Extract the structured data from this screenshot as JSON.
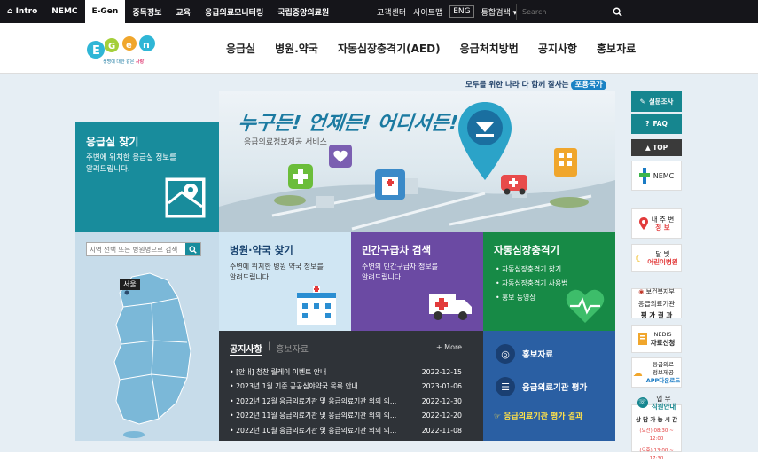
{
  "topbar": {
    "left_tabs": [
      "Intro",
      "NEMC",
      "E-Gen",
      "중독정보",
      "교육",
      "응급의료모니터링",
      "국립중앙의료원"
    ],
    "active_tab": "E-Gen",
    "right_links": [
      "고객센터",
      "사이트맵"
    ],
    "eng": "ENG",
    "unified_search": "통합검색",
    "search_placeholder": "Search"
  },
  "logo": {
    "text": "E-Gen",
    "tagline_a": "생명에 대한 같은",
    "tagline_b": "사랑"
  },
  "nav": [
    "응급실",
    "병원.약국",
    "자동심장충격기(AED)",
    "응급처치방법",
    "공지사항",
    "홍보자료"
  ],
  "slogan": {
    "text": "모두를 위한 나라 다 함께 잘사는",
    "badge": "포용국가"
  },
  "hero": {
    "title": "누구든! 언제든! 어디서든!",
    "sub": "응급의료정보제공 서비스"
  },
  "er_tile": {
    "title": "응급실 찾기",
    "desc1": "주변에 위치한 응급실 정보를",
    "desc2": "알려드립니다."
  },
  "map": {
    "placeholder": "지역 선택 또는 병원명으로 검색",
    "region": "서울"
  },
  "hospital_tile": {
    "title": "병원·약국 찾기",
    "desc1": "주변에 위치한 병원 약국 정보를",
    "desc2": "알려드립니다."
  },
  "ambulance_tile": {
    "title": "민간구급차 검색",
    "desc1": "주변의 민간구급차 정보를",
    "desc2": "알려드립니다."
  },
  "aed_tile": {
    "title": "자동심장충격기",
    "items": [
      "자동심장충격기 찾기",
      "자동심장충격기 사용법",
      "홍보 동영상"
    ]
  },
  "notice": {
    "tab_active": "공지사항",
    "tab_inactive": "홍보자료",
    "more": "+ More",
    "items": [
      {
        "title": "[안내] 청찬 릴레이 이벤트 안내",
        "date": "2022-12-15"
      },
      {
        "title": "2023년 1월 기준 공공심야약국 목록 안내",
        "date": "2023-01-06"
      },
      {
        "title": "2022년 12월 응급의료기관 및 응급의료기관 외의 의...",
        "date": "2022-12-30"
      },
      {
        "title": "2022년 11월 응급의료기관 및 응급의료기관 외의 의...",
        "date": "2022-12-20"
      },
      {
        "title": "2022년 10월 응급의료기관 및 응급의료기관 외의 의...",
        "date": "2022-11-08"
      }
    ]
  },
  "links_tile": {
    "item1": "홍보자료",
    "item2": "응급의료기관 평가",
    "item3": "응급의료기관 평가 결과"
  },
  "side": {
    "survey": "설문조사",
    "faq": "FAQ",
    "top": "▲ TOP",
    "nemc": "NEMC",
    "nearby_a": "내 주 변",
    "nearby_b": "정 보",
    "moon_a": "달 빛",
    "moon_b": "어린이병원",
    "mohw_a": "보건복지부",
    "mohw_b": "응급의료기관",
    "mohw_c": "평 가 결 과",
    "nedis_a": "NEDIS",
    "nedis_b": "자료신청",
    "app_a": "응급의료",
    "app_b": "정보제공",
    "app_c": "APP다운로드",
    "staff_a": "업 무",
    "staff_b": "직원안내",
    "consult": "상 담 가 능 시 간",
    "time1": "(오전) 08:30 ~ 12:00",
    "time2": "(오후) 13:00 ~ 17:30"
  },
  "colors": {
    "teal": "#188c9c",
    "purple": "#6b4aa3",
    "green": "#178a46",
    "navy": "#2a5fa3",
    "dark": "#2f3338"
  }
}
